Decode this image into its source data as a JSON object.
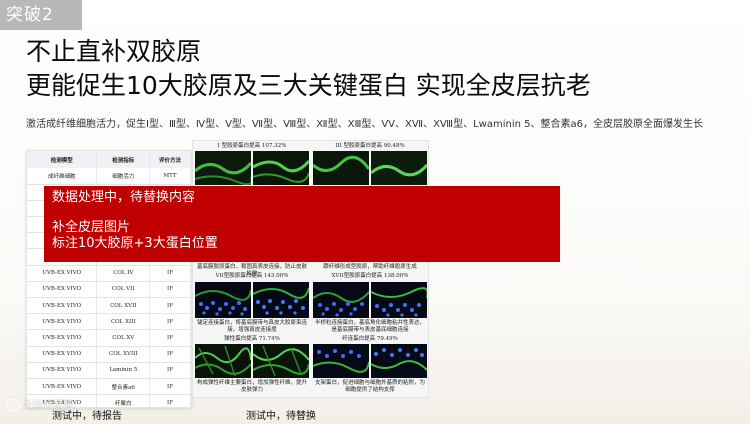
{
  "badge": "突破2",
  "title_line1": "不止直补双胶原",
  "title_line2": "更能促生10大胶原及三大关键蛋白 实现全皮层抗老",
  "description": "激活成纤维细胞活力，促生Ⅰ型、Ⅲ型、Ⅳ型、Ⅴ型、Ⅶ型、Ⅷ型、Ⅻ型、ⅩⅢ型、ⅤⅤ、ⅩⅦ、ⅩⅧ型、Lwaminin 5、整合素a6，全皮层胶原全面爆发生长",
  "overlay": {
    "line1": "数据处理中，待替换内容",
    "line2": "补全皮层图片",
    "line3": "标注10大胶原+3大蛋白位置"
  },
  "report": {
    "headers": [
      "检测模型",
      "检测指标",
      "评价方法"
    ],
    "rows": [
      [
        "成纤维细胞",
        "细胞活力",
        "MTT"
      ],
      [
        "",
        "",
        ""
      ],
      [
        "",
        "",
        ""
      ],
      [
        "",
        "",
        ""
      ],
      [
        "",
        "",
        ""
      ],
      [
        "",
        "",
        ""
      ],
      [
        "UVB-EX VIVO",
        "COL IV",
        "IF"
      ],
      [
        "UVB-EX VIVO",
        "COL VII",
        "IF"
      ],
      [
        "UVB-EX VIVO",
        "COL XVII",
        "IF"
      ],
      [
        "UVB-EX VIVO",
        "COL XIII",
        "IF"
      ],
      [
        "UVB-EX VIVO",
        "COL XV",
        "IF"
      ],
      [
        "UVB-EX VIVO",
        "COL XVIII",
        "IF"
      ],
      [
        "UVB-EX VIVO",
        "Laminin 5",
        "IF"
      ],
      [
        "UVB-EX VIVO",
        "整合素a6",
        "IF"
      ],
      [
        "UVB-EX VIVO",
        "纤聚白",
        "IF"
      ]
    ]
  },
  "grid_labels": {
    "top_left": "I 型胶原蛋白提高 107.32%",
    "top_right": "III 型胶原蛋白提高 90.48%",
    "mid_left_a": "基底膜胶原蛋白，稳固真表皮连接，防止皮肤松弛",
    "mid_right_a": "跟纤维形成型胶原，帮助纤维胶原生成",
    "mid_left_b": "VII型胶原蛋白提高 143.00%",
    "mid_right_b": "XVII型胶原蛋白提高 138.00%",
    "low_left_a": "锚定连接蛋白，将基底膜带与真皮大胶原束连接，增强真皮连接度",
    "low_right_a": "半桥粒连接蛋白，基底角化细胞粘并性表达，是基底膜带与表皮基底细胞连接",
    "low_left_b": "弹性蛋白提高 71.74%",
    "low_right_b": "纤连蛋白提高 79.49%",
    "bottom_left": "构成弹性纤维主要蛋白，增加弹性纤维，提升皮肤弹力",
    "bottom_right": "支架蛋白，促进细胞与细胞外基质的粘附，为细胞提供了结构支撑"
  },
  "captions": {
    "report": "测试中，待报告",
    "grid": "测试中，待替换"
  },
  "watermark": "大时代家居"
}
